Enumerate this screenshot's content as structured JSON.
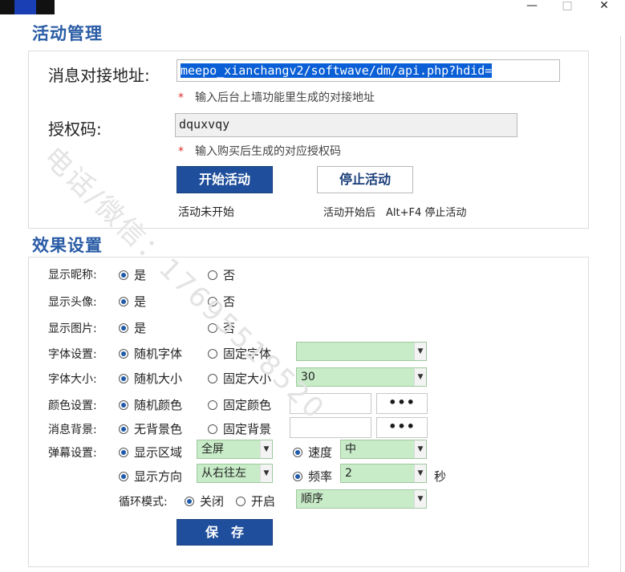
{
  "window": {
    "minimize": "—",
    "maximize": "□",
    "close": "✕"
  },
  "watermark": "电话/微信：17695518520",
  "activity": {
    "title": "活动管理",
    "url_label": "消息对接地址:",
    "url_value": "meepo_xianchangv2/softwave/dm/api.php?hdid=",
    "url_hint": "输入后台上墙功能里生成的对接地址",
    "code_label": "授权码:",
    "code_value": "dquxvqy",
    "code_hint": "输入购买后生成的对应授权码",
    "star": "*",
    "start_button": "开始活动",
    "stop_button": "停止活动",
    "status_text": "活动未开始",
    "stop_tip": "活动开始后　Alt+F4 停止活动"
  },
  "effects": {
    "title": "效果设置",
    "rows": {
      "nick": {
        "label": "显示昵称:",
        "opt1": "是",
        "opt2": "否"
      },
      "avatar": {
        "label": "显示头像:",
        "opt1": "是",
        "opt2": "否"
      },
      "image": {
        "label": "显示图片:",
        "opt1": "是",
        "opt2": "否"
      },
      "font": {
        "label": "字体设置:",
        "opt1": "随机字体",
        "opt2": "固定字体",
        "select": ""
      },
      "size": {
        "label": "字体大小:",
        "opt1": "随机大小",
        "opt2": "固定大小",
        "select": "30"
      },
      "color": {
        "label": "颜色设置:",
        "opt1": "随机颜色",
        "opt2": "固定颜色",
        "dots": "•••"
      },
      "bg": {
        "label": "消息背景:",
        "opt1": "无背景色",
        "opt2": "固定背景",
        "dots": "•••"
      }
    },
    "danmaku": {
      "label": "弹幕设置:",
      "area_label": "显示区域",
      "area_value": "全屏",
      "speed_label": "速度",
      "speed_value": "中",
      "dir_label": "显示方向",
      "dir_value": "从右往左",
      "freq_label": "频率",
      "freq_value": "2",
      "freq_unit": "秒"
    },
    "loop": {
      "label": "循环模式:",
      "off": "关闭",
      "on": "开启",
      "mode": "顺序"
    },
    "save_button": "保　存"
  },
  "colors": {
    "accent": "#2a5ca6",
    "button": "#1f4f9c",
    "select_bg": "#c8ecc8",
    "required": "#e03030"
  }
}
